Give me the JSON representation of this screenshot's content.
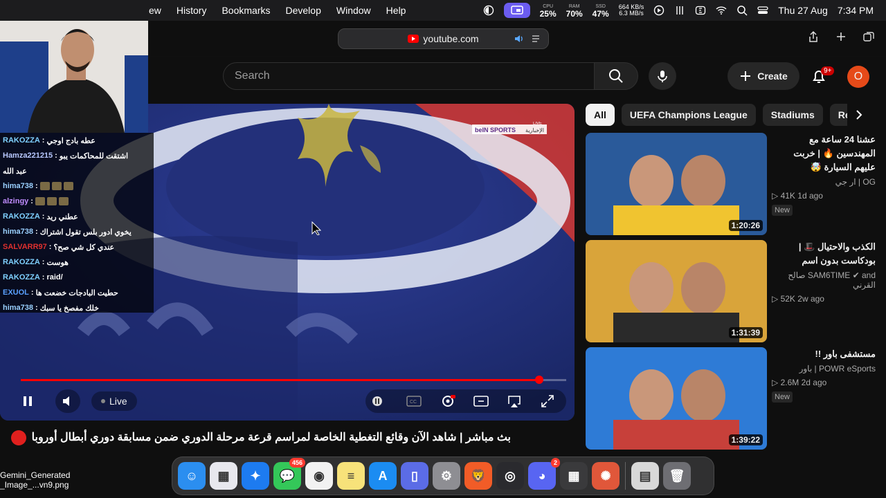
{
  "menubar": {
    "menus": [
      "ew",
      "History",
      "Bookmarks",
      "Develop",
      "Window",
      "Help"
    ],
    "cpu_label": "CPU",
    "cpu": "25%",
    "ram_label": "RAM",
    "ram": "70%",
    "ssd_label": "SSD",
    "ssd": "47%",
    "net_up": "664 KB/s",
    "net_down": "6.3 MB/s",
    "date": "Thu 27 Aug",
    "time": "7:34 PM"
  },
  "safari": {
    "url": "youtube.com"
  },
  "youtube": {
    "search_placeholder": "Search",
    "create_label": "Create",
    "notif_count": "9+",
    "avatar_letter": "O"
  },
  "player": {
    "live_label": "Live",
    "progress": 0.95,
    "channel_logo_text": "beIN SPORTS",
    "channel_sub": "الإخبارية",
    "live_tag": "LIVE"
  },
  "chat": [
    {
      "user": "RAKOZZA",
      "msg": "عطه بادج اوجي",
      "color": "#7fd0ff"
    },
    {
      "user": "Hamza221215",
      "msg": "اشتقت للمحاكمات يبو",
      "color": "#b8c8ff"
    },
    {
      "user": "",
      "msg": "عبد الله",
      "color": "#fff"
    },
    {
      "user": "hima738",
      "msg": "",
      "color": "#9ad0ff"
    },
    {
      "user": "alzingy",
      "msg": "",
      "color": "#c08cff"
    },
    {
      "user": "RAKOZZA",
      "msg": "عطني ريد",
      "color": "#7fd0ff"
    },
    {
      "user": "hima738",
      "msg": "يخوي ادور بلس تقول اشتراك",
      "color": "#9ad0ff"
    },
    {
      "user": "SALVARR97",
      "msg": "عندي كل شي صح؟",
      "color": "#e0302e"
    },
    {
      "user": "RAKOZZA",
      "msg": "هوست",
      "color": "#7fd0ff"
    },
    {
      "user": "RAKOZZA",
      "msg": "/raid",
      "color": "#7fd0ff"
    },
    {
      "user": "EXUOL",
      "msg": "حطيت البادجات خضعت ها",
      "color": "#5aa0ff"
    },
    {
      "user": "hima738",
      "msg": "خلك مفصخ يا سبك",
      "color": "#9ad0ff"
    }
  ],
  "video_title": "بث مباشر | شاهد الآن وقائع التغطية الخاصة لمراسم قرعة مرحلة الدوري ضمن مسابقة دوري أبطال أوروبا",
  "chips": [
    "All",
    "UEFA Champions League",
    "Stadiums",
    "Rela"
  ],
  "recommended": [
    {
      "title": "عشنا 24 ساعة مع المهندسين 🔥 | خربت عليهم السيارة 🤯",
      "channel": "OG | ار جي",
      "views": "41K",
      "age": "1d ago",
      "badge": "New",
      "duration": "1:20:26"
    },
    {
      "title": "الكذب والاحتيال 🎩 | بودكاست بدون اسم",
      "channel": "SAM6TIME ✔ and صالح القرني",
      "views": "52K",
      "age": "2w ago",
      "badge": "",
      "duration": "1:31:39"
    },
    {
      "title": "مستشفى باور !!",
      "channel": "POWR eSports | باور",
      "views": "2.6M",
      "age": "2d ago",
      "badge": "New",
      "duration": "1:39:22"
    }
  ],
  "desktop_file": {
    "name_line1": "Gemini_Generated",
    "name_line2": "_Image_...vn9.png"
  },
  "dock": [
    {
      "name": "Finder",
      "color": "#2b8ef0",
      "glyph": "☺",
      "badge": ""
    },
    {
      "name": "Launchpad",
      "color": "#e8e8ee",
      "glyph": "▦",
      "badge": ""
    },
    {
      "name": "Safari",
      "color": "#1d7bf0",
      "glyph": "✦",
      "badge": ""
    },
    {
      "name": "Messages",
      "color": "#34c759",
      "glyph": "💬",
      "badge": "456"
    },
    {
      "name": "Chrome",
      "color": "#f2f2f2",
      "glyph": "◉",
      "badge": ""
    },
    {
      "name": "Notes",
      "color": "#f7e27a",
      "glyph": "≡",
      "badge": ""
    },
    {
      "name": "App Store",
      "color": "#1b8cf2",
      "glyph": "A",
      "badge": ""
    },
    {
      "name": "Files",
      "color": "#5b6ce6",
      "glyph": "▯",
      "badge": ""
    },
    {
      "name": "Settings",
      "color": "#8e8e93",
      "glyph": "⚙",
      "badge": ""
    },
    {
      "name": "Brave",
      "color": "#f25c27",
      "glyph": "🦁",
      "badge": ""
    },
    {
      "name": "OBS",
      "color": "#2a2a2e",
      "glyph": "◎",
      "badge": ""
    },
    {
      "name": "Discord",
      "color": "#5865f2",
      "glyph": "◕",
      "badge": "2"
    },
    {
      "name": "Calculator",
      "color": "#3a3a3c",
      "glyph": "▦",
      "badge": ""
    },
    {
      "name": "Claude",
      "color": "#e0573a",
      "glyph": "✺",
      "badge": ""
    },
    {
      "name": "Preview",
      "color": "#d8d8d8",
      "glyph": "▤",
      "badge": ""
    },
    {
      "name": "Trash",
      "color": "#6e6e73",
      "glyph": "🗑",
      "badge": ""
    }
  ]
}
